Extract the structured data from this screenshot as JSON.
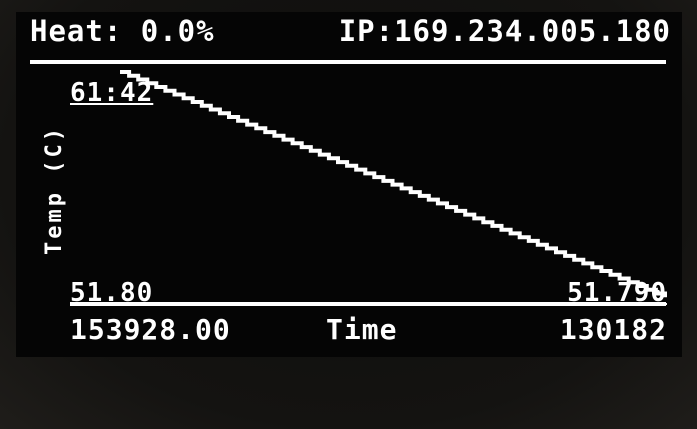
{
  "header": {
    "heat_text": "Heat: 0.0%",
    "ip_text": "IP:169.234.005.180"
  },
  "chart_data": {
    "type": "line",
    "ylabel": "Temp (C)",
    "xlabel": "Time",
    "y_max_label": "61:42",
    "y_min_label": "51.80",
    "end_value_label": "51.790",
    "x_start_label": "153928.00",
    "x_end_label": "130182",
    "x_range": [
      153928,
      130182
    ],
    "ylim": [
      51.8,
      61.42
    ],
    "series": [
      {
        "x": [
          153928,
          130182
        ],
        "y": [
          61.42,
          51.79
        ]
      }
    ],
    "grid": false,
    "colors": {
      "line": "#ffffff",
      "background": "#050505"
    }
  }
}
